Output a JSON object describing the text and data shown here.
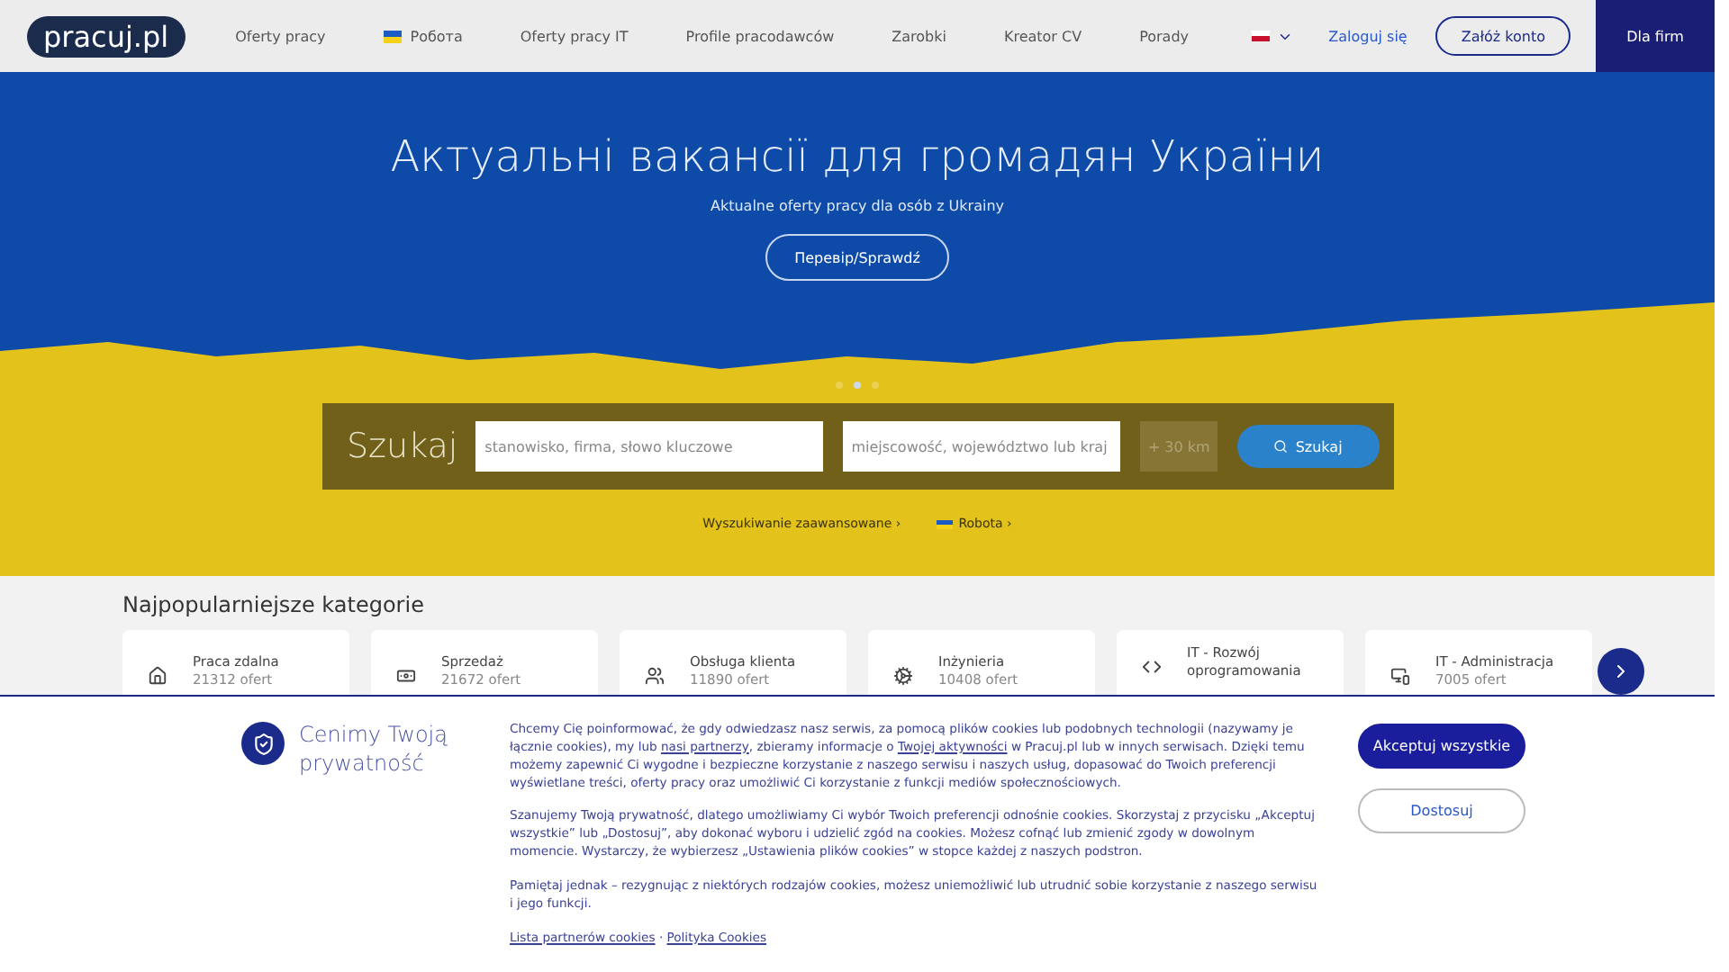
{
  "header": {
    "logo": "pracuj.pl",
    "nav": [
      {
        "label": "Oferty pracy",
        "flag": false
      },
      {
        "label": "Робота",
        "flag": true
      },
      {
        "label": "Oferty pracy IT",
        "flag": false
      },
      {
        "label": "Profile pracodawców",
        "flag": false
      },
      {
        "label": "Zarobki",
        "flag": false
      },
      {
        "label": "Kreator CV",
        "flag": false
      },
      {
        "label": "Porady",
        "flag": false
      }
    ],
    "login": "Zaloguj się",
    "register": "Załóż konto",
    "employers": "Dla firm"
  },
  "hero": {
    "title": "Актуальні вакансії для громадян України",
    "subtitle": "Aktualne oferty pracy dla osób z Ukrainy",
    "button": "Перевір/Sprawdź",
    "dots": [
      {
        "selected": false
      },
      {
        "selected": true
      },
      {
        "selected": false
      }
    ]
  },
  "search": {
    "label": "Szukaj",
    "keyword_placeholder": "stanowisko, firma, słowo kluczowe",
    "location_placeholder": "miejscowość, województwo lub kraj",
    "distance": "+ 30 km",
    "button": "Szukaj",
    "links": [
      {
        "label": "Wyszukiwanie zaawansowane ›",
        "flag": false
      },
      {
        "label": "Robota ›",
        "flag": true
      }
    ]
  },
  "categories": {
    "title": "Najpopularniejsze kategorie",
    "items": [
      {
        "kind": "home",
        "name": "Praca zdalna",
        "count": "21312 ofert"
      },
      {
        "kind": "money",
        "name": "Sprzedaż",
        "count": "21672 ofert"
      },
      {
        "kind": "people",
        "name": "Obsługa klienta",
        "count": "11890 ofert"
      },
      {
        "kind": "gear",
        "name": "Inżynieria",
        "count": "10408 ofert"
      },
      {
        "kind": "code",
        "name": "IT - Rozwój oprogramowania"
      },
      {
        "kind": "devices",
        "name": "IT - Administracja",
        "count": "7005 ofert"
      }
    ]
  },
  "cookies": {
    "title": "Cenimy Twoją prywatność",
    "intro": [
      {
        "text": "Chcemy Cię poinformować, że gdy odwiedzasz nasz serwis, za pomocą plików cookies lub podobnych technologii (nazywamy je łącznie cookies), my lub",
        "link": false
      },
      {
        "text": "nasi partnerzy",
        "link": true
      },
      {
        "text": ", zbieramy informacje o",
        "link": false
      },
      {
        "text": "Twojej aktywności",
        "link": true
      },
      {
        "text": "w Pracuj.pl lub w innych serwisach. Dzięki temu możemy zapewnić Ci wygodne i bezpieczne korzystanie z naszego serwisu i naszych usług, dopasować do Twoich preferencji wyświetlane treści, oferty pracy oraz umożliwić Ci korzystanie z funkcji mediów społecznościowych.",
        "link": false
      }
    ],
    "paragraphs": [
      "Szanujemy Twoją prywatność, dlatego umożliwiamy Ci wybór Twoich preferencji odnośnie cookies. Skorzystaj z przycisku „Akceptuj wszystkie” lub „Dostosuj”, aby dokonać wyboru i udzielić zgód na cookies. Możesz cofnąć lub zmienić zgody w dowolnym momencie. Wystarczy, że wybierzesz „Ustawienia plików cookies” w stopce każdej z naszych podstron.",
      "Pamiętaj jednak – rezygnując z niektórych rodzajów cookies, możesz uniemożliwić lub utrudnić sobie korzystanie z naszego serwisu i jego funkcji."
    ],
    "links": [
      "Lista partnerów cookies",
      "Polityka Cookies"
    ],
    "separator": "·",
    "accept": "Akceptuj wszystkie",
    "customize": "Dostosuj"
  }
}
